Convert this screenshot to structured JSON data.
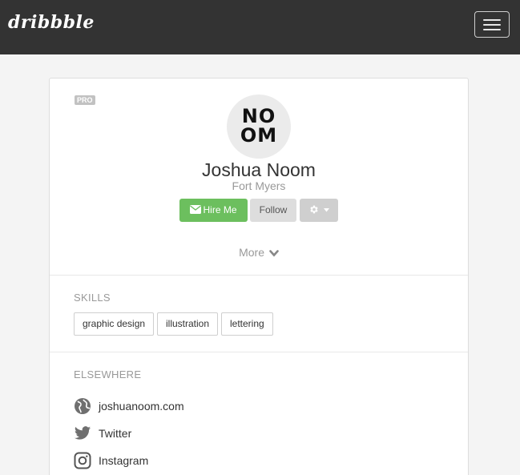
{
  "navbar": {
    "brand": "dribbble",
    "menu_icon": "hamburger-icon"
  },
  "profile": {
    "badge": "PRO",
    "avatar_text_line1": "NO",
    "avatar_text_line2": "OM",
    "name": "Joshua Noom",
    "location": "Fort Myers",
    "actions": {
      "hire_label": "Hire Me",
      "hire_icon": "envelope-icon",
      "follow_label": "Follow",
      "settings_icon": "gear-icon"
    },
    "more_label": "More",
    "colors": {
      "hire": "#6cbf5e",
      "navbar": "#333333"
    }
  },
  "skills": {
    "title": "SKILLS",
    "items": [
      "graphic design",
      "illustration",
      "lettering"
    ]
  },
  "elsewhere": {
    "title": "ELSEWHERE",
    "links": [
      {
        "label": "joshuanoom.com",
        "icon": "globe-icon"
      },
      {
        "label": "Twitter",
        "icon": "twitter-icon"
      },
      {
        "label": "Instagram",
        "icon": "instagram-icon"
      }
    ]
  }
}
